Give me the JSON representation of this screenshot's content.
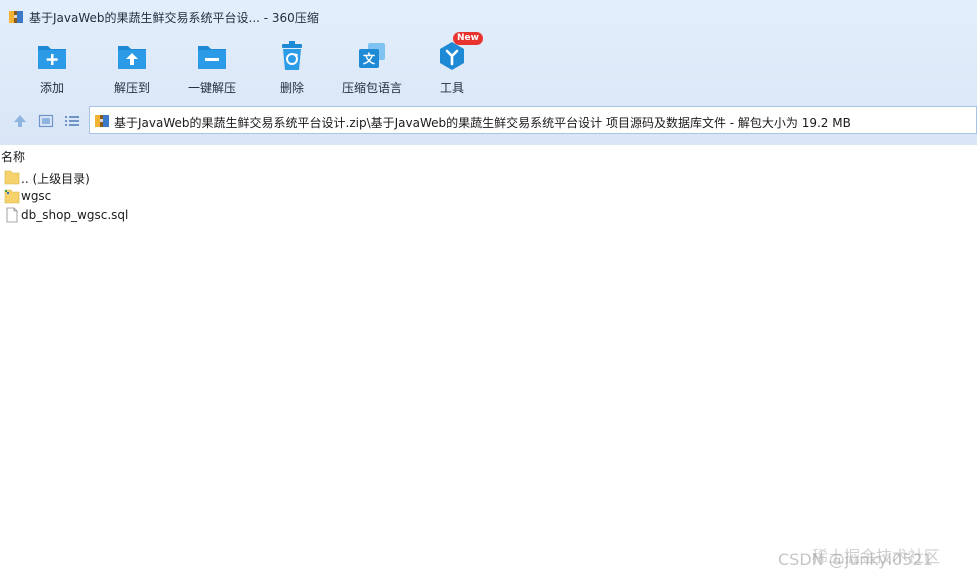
{
  "window": {
    "title": "基于JavaWeb的果蔬生鲜交易系统平台设... - 360压缩"
  },
  "toolbar": {
    "items": [
      {
        "label": "添加",
        "icon": "add-icon"
      },
      {
        "label": "解压到",
        "icon": "extract-to-icon"
      },
      {
        "label": "一键解压",
        "icon": "one-click-extract-icon"
      },
      {
        "label": "删除",
        "icon": "delete-icon"
      },
      {
        "label": "压缩包语言",
        "icon": "archive-language-icon"
      },
      {
        "label": "工具",
        "icon": "tools-icon",
        "badge": "New"
      }
    ]
  },
  "address": {
    "path": "基于JavaWeb的果蔬生鲜交易系统平台设计.zip\\基于JavaWeb的果蔬生鲜交易系统平台设计 项目源码及数据库文件 - 解包大小为 19.2 MB"
  },
  "file_list": {
    "column_name": "名称",
    "rows": [
      {
        "name": ".. (上级目录)",
        "icon": "folder-up-icon"
      },
      {
        "name": "wgsc",
        "icon": "folder-icon"
      },
      {
        "name": "db_shop_wgsc.sql",
        "icon": "file-icon"
      }
    ]
  },
  "watermark": {
    "text": "CSDN @junkyi0521",
    "text2": "稀土掘金技术社区"
  },
  "colors": {
    "accent": "#1e8ad6",
    "badge": "#e8342e",
    "folder": "#f5d26b"
  }
}
